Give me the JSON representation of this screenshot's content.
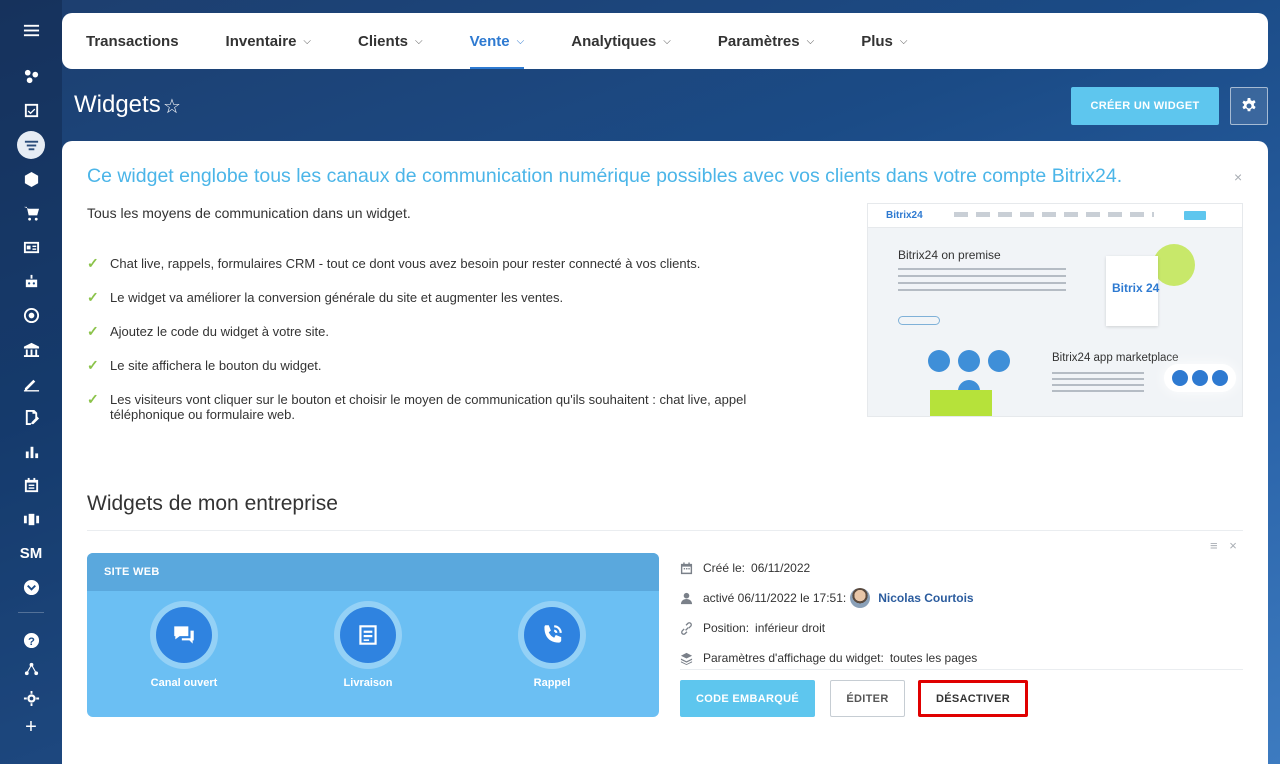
{
  "nav": {
    "items": [
      {
        "label": "Transactions",
        "chevron": false,
        "active": false
      },
      {
        "label": "Inventaire",
        "chevron": true,
        "active": false
      },
      {
        "label": "Clients",
        "chevron": true,
        "active": false
      },
      {
        "label": "Vente",
        "chevron": true,
        "active": true
      },
      {
        "label": "Analytiques",
        "chevron": true,
        "active": false
      },
      {
        "label": "Paramètres",
        "chevron": true,
        "active": false
      },
      {
        "label": "Plus",
        "chevron": true,
        "active": false
      }
    ]
  },
  "rail": {
    "initials": "SM",
    "help": "?",
    "add": "+"
  },
  "header": {
    "title": "Widgets",
    "star": "☆",
    "create_button": "CRÉER UN WIDGET"
  },
  "intro": {
    "title": "Ce widget englobe tous les canaux de communication numérique possibles avec vos clients dans votre compte Bitrix24.",
    "subtitle": "Tous les moyens de communication dans un widget.",
    "close": "×",
    "features": [
      "Chat live, rappels, formulaires CRM - tout ce dont vous avez besoin pour rester connecté à vos clients.",
      "Le widget va améliorer la conversion générale du site et augmenter les ventes.",
      "Ajoutez le code du widget à votre site.",
      "Le site affichera le bouton du widget.",
      "Les visiteurs vont cliquer sur le bouton et choisir le moyen de communication qu'ils souhaitent : chat live, appel téléphonique ou formulaire web."
    ],
    "preview": {
      "logo": "Bitrix24",
      "heading1": "Bitrix24 on premise",
      "heading2": "Bitrix24 app marketplace",
      "box_text": "Bitrix 24"
    }
  },
  "section": {
    "title": "Widgets de mon entreprise",
    "menu": "≡ ×"
  },
  "widget": {
    "type_label": "SITE WEB",
    "channels": [
      {
        "label": "Canal ouvert",
        "icon": "chat-icon"
      },
      {
        "label": "Livraison",
        "icon": "form-icon"
      },
      {
        "label": "Rappel",
        "icon": "phone-icon"
      }
    ],
    "created_label": "Créé le:",
    "created_value": "06/11/2022",
    "activated_label": "activé 06/11/2022 le 17:51:",
    "activated_user": "Nicolas Courtois",
    "position_label": "Position:",
    "position_value": "inférieur droit",
    "display_label": "Paramètres d'affichage du widget:",
    "display_value": "toutes les pages",
    "buttons": {
      "embed": "CODE EMBARQUÉ",
      "edit": "ÉDITER",
      "disable": "DÉSACTIVER"
    }
  },
  "colors": {
    "accent": "#2e7ad1",
    "intro_title": "#4bb5e8",
    "primary_button": "#5ec6ee",
    "card": "#6bbff3",
    "highlight_border": "#e00000"
  }
}
